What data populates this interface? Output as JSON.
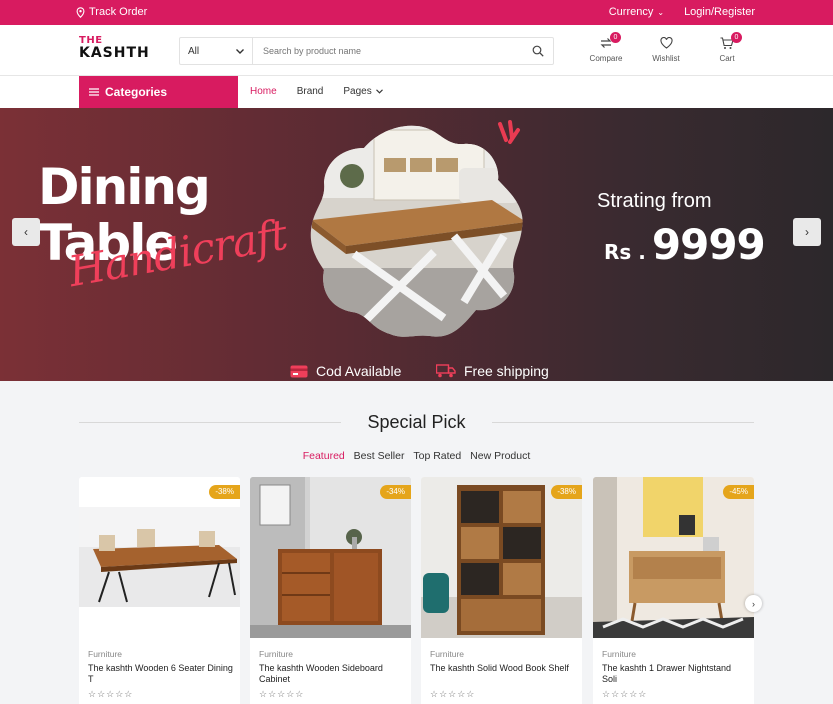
{
  "topbar": {
    "track_order": "Track Order",
    "currency": "Currency",
    "login": "Login/Register"
  },
  "header": {
    "logo_line1": "THE",
    "logo_line2": "KASHTH",
    "search": {
      "category": "All",
      "placeholder": "Search by product name"
    },
    "compare": {
      "label": "Compare",
      "count": "0"
    },
    "wishlist": {
      "label": "Wishlist"
    },
    "cart": {
      "label": "Cart",
      "count": "0"
    }
  },
  "nav": {
    "categories": "Categories",
    "links": [
      {
        "label": "Home",
        "active": true
      },
      {
        "label": "Brand",
        "active": false
      },
      {
        "label": "Pages",
        "active": false
      }
    ]
  },
  "hero": {
    "title_line1": "Dining",
    "title_line2": "Table",
    "script": "Handicraft",
    "from": "Strating from",
    "currency": "Rs .",
    "price": "9999",
    "features": [
      "Cod Available",
      "Free shipping"
    ]
  },
  "special": {
    "title": "Special Pick",
    "tabs": [
      {
        "label": "Featured",
        "active": true
      },
      {
        "label": "Best Seller",
        "active": false
      },
      {
        "label": "Top Rated",
        "active": false
      },
      {
        "label": "New Product",
        "active": false
      }
    ],
    "products": [
      {
        "discount": "-38%",
        "category": "Furniture",
        "name": "The kashth Wooden 6 Seater Dining T",
        "stars": "☆☆☆☆☆"
      },
      {
        "discount": "-34%",
        "category": "Furniture",
        "name": "The kashth Wooden Sideboard Cabinet",
        "stars": "☆☆☆☆☆"
      },
      {
        "discount": "-38%",
        "category": "Furniture",
        "name": "The kashth Solid Wood Book Shelf",
        "stars": "☆☆☆☆☆"
      },
      {
        "discount": "-45%",
        "category": "Furniture",
        "name": "The kashth 1 Drawer Nightstand Soli",
        "stars": "☆☆☆☆☆"
      }
    ]
  },
  "colors": {
    "brand": "#d81b60",
    "badge": "#e5a51b"
  }
}
